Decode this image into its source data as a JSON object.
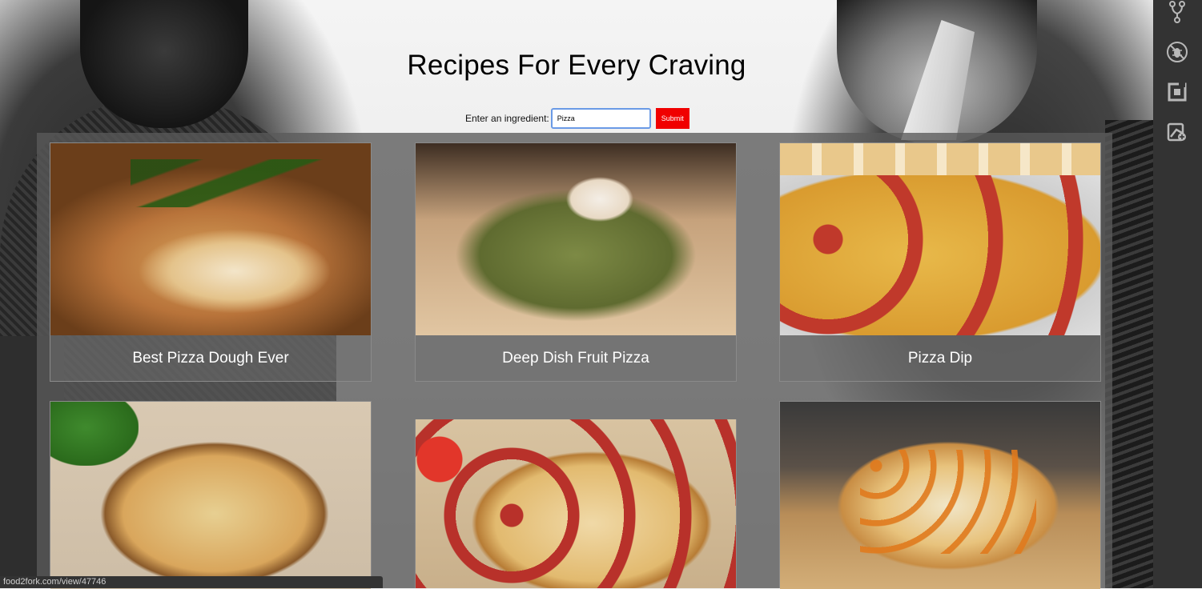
{
  "header": {
    "title": "Recipes For Every Craving"
  },
  "search": {
    "label": "Enter an ingredient:",
    "value": "Pizza",
    "submit_label": "Submit"
  },
  "recipes": [
    {
      "title": "Best Pizza Dough Ever"
    },
    {
      "title": "Deep Dish Fruit Pizza"
    },
    {
      "title": "Pizza Dip"
    },
    {
      "title": ""
    },
    {
      "title": ""
    },
    {
      "title": ""
    }
  ],
  "toolbar": {
    "icons": [
      "source-control-icon",
      "debug-icon",
      "extensions-icon",
      "remote-explorer-icon"
    ]
  },
  "status": {
    "url": "food2fork.com/view/47746"
  },
  "colors": {
    "submit_bg": "#f00000",
    "input_focus": "#6a9ae6",
    "toolbar_bg": "#333333"
  }
}
